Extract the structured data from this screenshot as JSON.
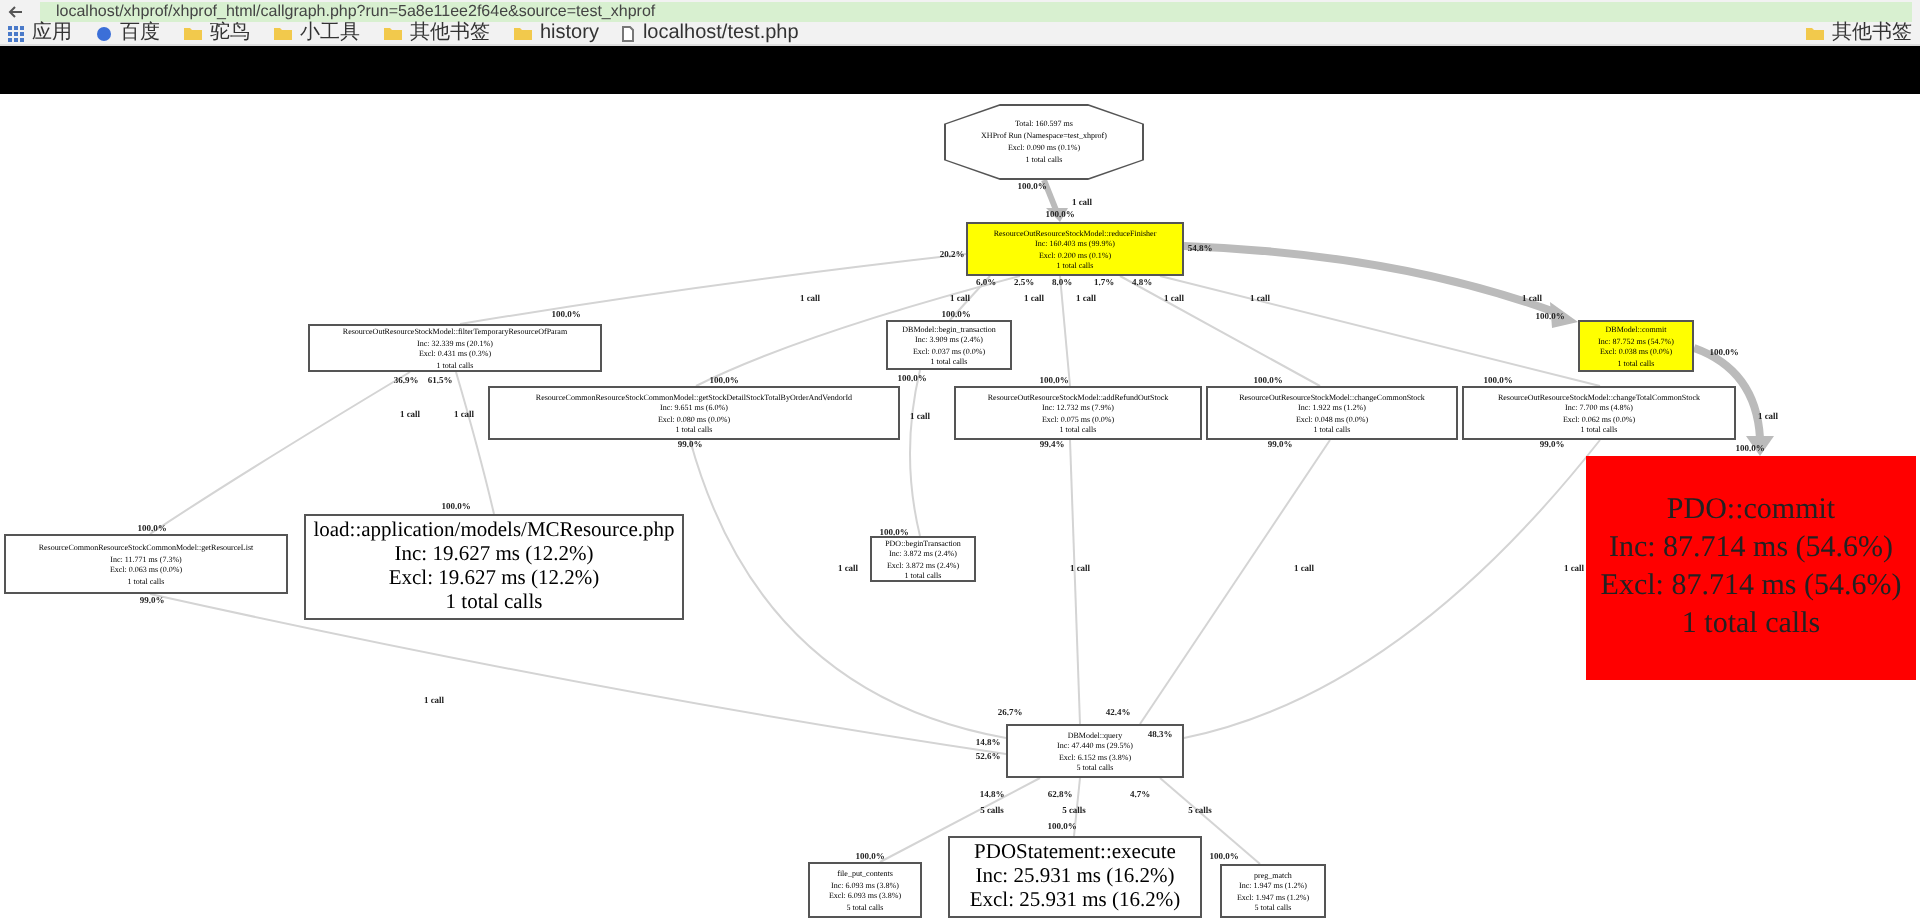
{
  "browser": {
    "url": "localhost/xhprof/xhprof_html/callgraph.php?run=5a8e11ee2f64e&source=test_xhprof",
    "bookmarks": [
      {
        "label": "应用",
        "kind": "apps"
      },
      {
        "label": "百度",
        "kind": "site"
      },
      {
        "label": "驼鸟",
        "kind": "folder"
      },
      {
        "label": "小工具",
        "kind": "folder"
      },
      {
        "label": "其他书签",
        "kind": "folder"
      },
      {
        "label": "history",
        "kind": "folder"
      },
      {
        "label": "localhost/test.php",
        "kind": "page"
      }
    ],
    "other_bookmarks": "其他书签"
  },
  "graph": {
    "nodes": [
      {
        "kind": "root",
        "lines": [
          "Total: 160.597 ms",
          "XHProf Run (Namespace=test_xhprof)",
          "Excl: 0.090 ms (0.1%)",
          "1 total calls"
        ]
      },
      {
        "kind": "highlight",
        "lines": [
          "ResourceOutResourceStockModel::reduceFinisher",
          "Inc: 160.403 ms (99.9%)",
          "Excl: 0.200 ms (0.1%)",
          "1 total calls"
        ]
      },
      {
        "kind": "normal",
        "lines": [
          "ResourceOutResourceStockModel::filterTemporaryResourceOfParam",
          "Inc: 32.339 ms (20.1%)",
          "Excl: 0.431 ms (0.3%)",
          "1 total calls"
        ]
      },
      {
        "kind": "normal",
        "lines": [
          "DBModel::begin_transaction",
          "Inc: 3.909 ms (2.4%)",
          "Excl: 0.037 ms (0.0%)",
          "1 total calls"
        ]
      },
      {
        "kind": "highlight",
        "lines": [
          "DBModel::commit",
          "Inc: 87.752 ms (54.7%)",
          "Excl: 0.038 ms (0.0%)",
          "1 total calls"
        ]
      },
      {
        "kind": "normal",
        "lines": [
          "ResourceCommonResourceStockCommonModel::getStockDetailStockTotalByOrderAndVendorId",
          "Inc: 9.651 ms (6.0%)",
          "Excl: 0.080 ms (0.0%)",
          "1 total calls"
        ]
      },
      {
        "kind": "normal",
        "lines": [
          "ResourceOutResourceStockModel::addRefundOutStock",
          "Inc: 12.732 ms (7.9%)",
          "Excl: 0.075 ms (0.0%)",
          "1 total calls"
        ]
      },
      {
        "kind": "normal",
        "lines": [
          "ResourceOutResourceStockModel::changeCommonStock",
          "Inc: 1.922 ms (1.2%)",
          "Excl: 0.048 ms (0.0%)",
          "1 total calls"
        ]
      },
      {
        "kind": "normal",
        "lines": [
          "ResourceOutResourceStockModel::changeTotalCommonStock",
          "Inc: 7.700 ms (4.8%)",
          "Excl: 0.062 ms (0.0%)",
          "1 total calls"
        ]
      },
      {
        "kind": "normal",
        "lines": [
          "ResourceCommonResourceStockCommonModel::getResourceList",
          "Inc: 11.771 ms (7.3%)",
          "Excl: 0.063 ms (0.0%)",
          "1 total calls"
        ]
      },
      {
        "kind": "large",
        "lines": [
          "load::application/models/MCResource.php",
          "Inc: 19.627 ms (12.2%)",
          "Excl: 19.627 ms (12.2%)",
          "1 total calls"
        ]
      },
      {
        "kind": "normal",
        "lines": [
          "PDO::beginTransaction",
          "Inc: 3.872 ms (2.4%)",
          "Excl: 3.872 ms (2.4%)",
          "1 total calls"
        ]
      },
      {
        "kind": "hot",
        "lines": [
          "PDO::commit",
          "Inc: 87.714 ms (54.6%)",
          "Excl: 87.714 ms (54.6%)",
          "1 total calls"
        ]
      },
      {
        "kind": "normal",
        "lines": [
          "DBModel::query",
          "Inc: 47.440 ms (29.5%)",
          "Excl: 6.152 ms (3.8%)",
          "5 total calls"
        ]
      },
      {
        "kind": "normal",
        "lines": [
          "file_put_contents",
          "Inc: 6.093 ms (3.8%)",
          "Excl: 6.093 ms (3.8%)",
          "5 total calls"
        ]
      },
      {
        "kind": "large",
        "lines": [
          "PDOStatement::execute",
          "Inc: 25.931 ms (16.2%)",
          "Excl: 25.931 ms (16.2%)"
        ]
      },
      {
        "kind": "normal",
        "lines": [
          "preg_match",
          "Inc: 1.947 ms (1.2%)",
          "Excl: 1.947 ms (1.2%)",
          "5 total calls"
        ]
      }
    ],
    "edge_labels": [
      "100.0%",
      "1 call",
      "100.0%",
      "20.2%",
      "54.8%",
      "6.0%",
      "2.5%",
      "8.0%",
      "1.7%",
      "4.8%",
      "1 call",
      "1 call",
      "1 call",
      "1 call",
      "1 call",
      "1 call",
      "1 call",
      "100.0%",
      "100.0%",
      "100.0%",
      "100.0%",
      "36.9%",
      "61.5%",
      "1 call",
      "1 call",
      "100.0%",
      "100.0%",
      "1 call",
      "100.0%",
      "100.0%",
      "100.0%",
      "1 call",
      "100.0%",
      "99.0%",
      "99.4%",
      "99.0%",
      "99.0%",
      "100.0%",
      "100.0%",
      "99.0%",
      "100.0%",
      "1 call",
      "1 call",
      "1 call",
      "1 call",
      "1 call",
      "26.7%",
      "42.4%",
      "48.3%",
      "14.8%",
      "52.6%",
      "14.8%",
      "62.8%",
      "4.7%",
      "5 calls",
      "5 calls",
      "5 calls",
      "100.0%",
      "100.0%",
      "100.0%"
    ]
  }
}
